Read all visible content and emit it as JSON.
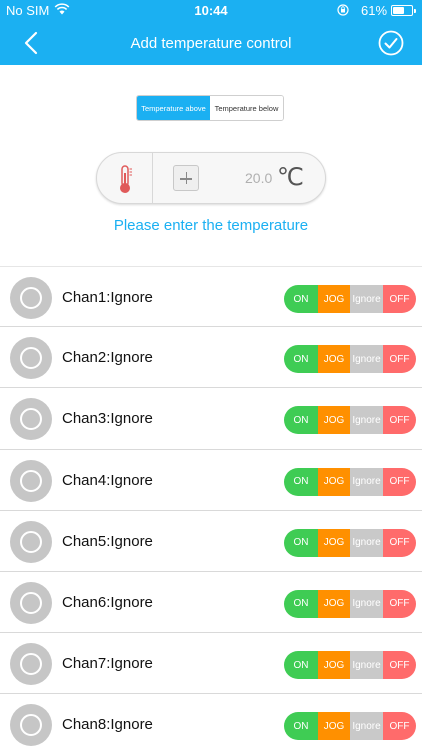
{
  "status_bar": {
    "carrier": "No SIM",
    "time": "10:44",
    "battery": "61%",
    "battery_level": 0.61
  },
  "nav": {
    "title": "Add temperature control",
    "back_icon": "chevron-left-icon",
    "confirm_icon": "check-circle-icon"
  },
  "segment": {
    "options": [
      "Temperature above",
      "Temperature below"
    ],
    "selected": 0
  },
  "temperature": {
    "value": "20.0",
    "unit": "℃",
    "hint": "Please enter the temperature"
  },
  "channels": [
    {
      "label": "Chan1:Ignore"
    },
    {
      "label": "Chan2:Ignore"
    },
    {
      "label": "Chan3:Ignore"
    },
    {
      "label": "Chan4:Ignore"
    },
    {
      "label": "Chan5:Ignore"
    },
    {
      "label": "Chan6:Ignore"
    },
    {
      "label": "Chan7:Ignore"
    },
    {
      "label": "Chan8:Ignore"
    }
  ],
  "toggle_labels": {
    "on": "ON",
    "jog": "JOG",
    "ignore": "Ignore",
    "off": "OFF"
  },
  "colors": {
    "accent": "#1bb0f2",
    "on": "#3fcc54",
    "jog": "#ff9000",
    "ignore": "#c9c9c9",
    "off": "#ff6b6b"
  }
}
